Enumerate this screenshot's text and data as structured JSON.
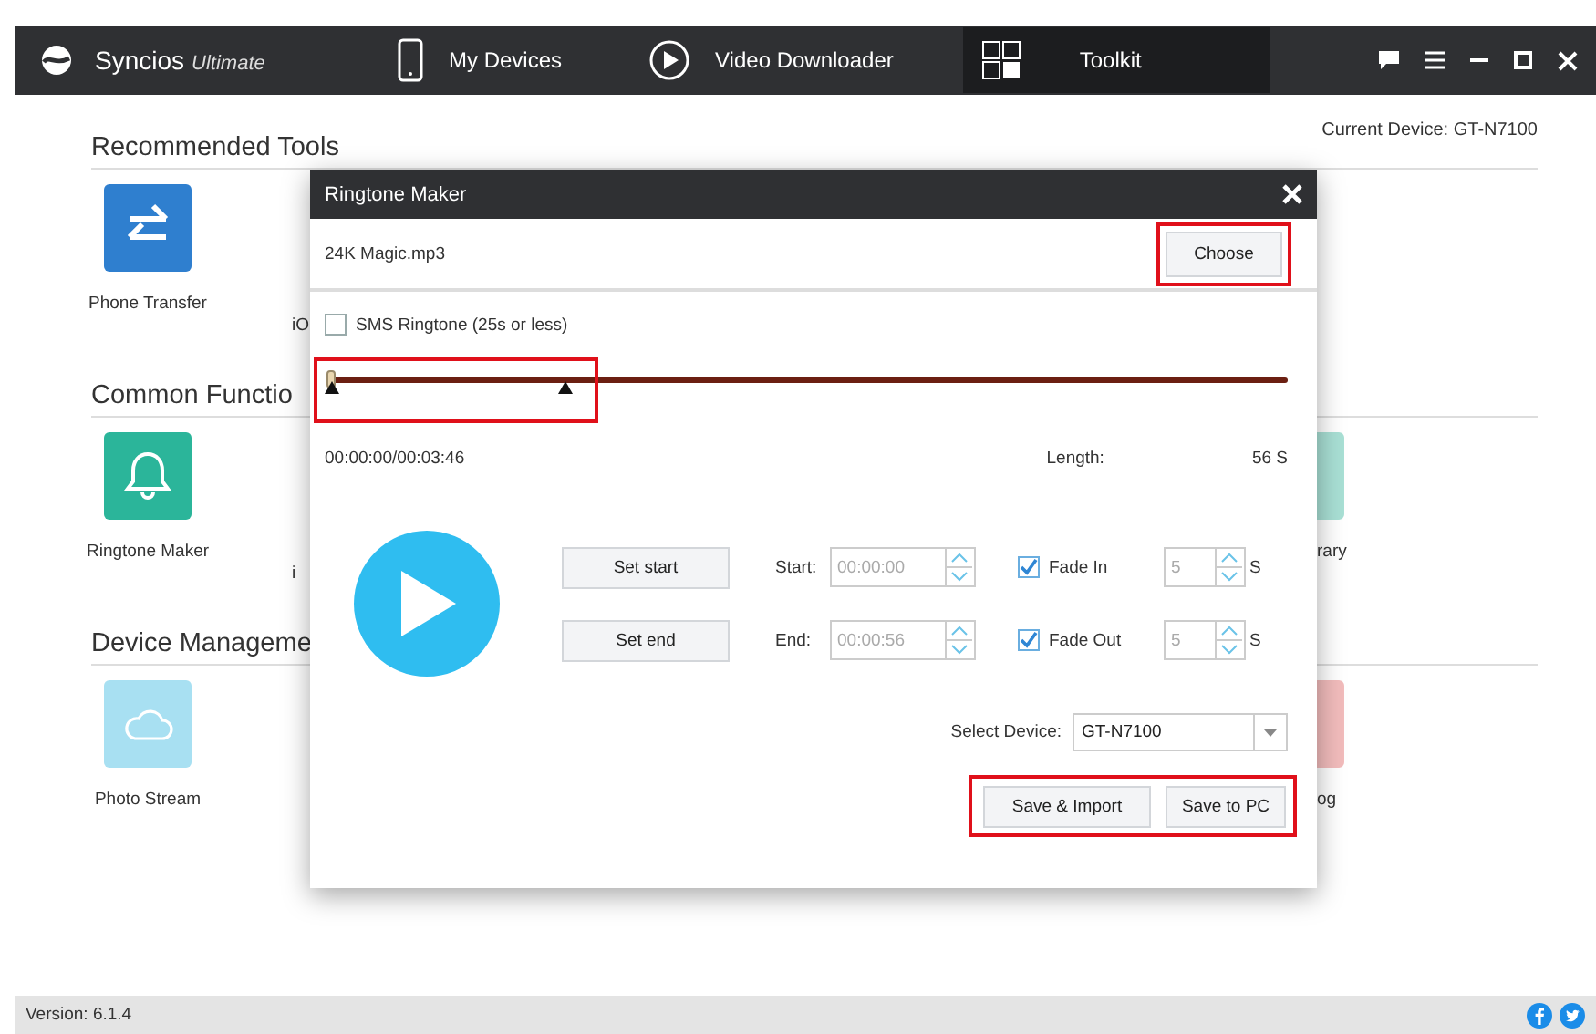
{
  "app_bar": {
    "brand": "Syncios",
    "edition": "Ultimate",
    "nav": [
      {
        "label": "My Devices",
        "selected": false
      },
      {
        "label": "Video Downloader",
        "selected": false
      },
      {
        "label": "Toolkit",
        "selected": true
      }
    ]
  },
  "current_device": "Current Device: GT-N7100",
  "sections": [
    {
      "title": "Recommended Tools",
      "tools": [
        {
          "kind": "tool",
          "label": "Phone Transfer",
          "color": "#2f7fcf"
        },
        {
          "kind": "fragment",
          "label": "iO"
        }
      ]
    },
    {
      "title": "Common Functio",
      "tools": [
        {
          "kind": "tool",
          "label": "Ringtone Maker",
          "color": "#2bb59a"
        },
        {
          "kind": "fragment",
          "label": "i"
        },
        {
          "kind": "edge",
          "label": "rary",
          "color": "#a9e0d5"
        }
      ]
    },
    {
      "title": "Device Manageme",
      "tools": [
        {
          "kind": "tool",
          "label": "Photo Stream",
          "color": "#a8e0f2"
        },
        {
          "kind": "edge",
          "label": "og",
          "color": "#f2bcbc"
        }
      ]
    }
  ],
  "dialog": {
    "title": "Ringtone Maker",
    "file": "24K Magic.mp3",
    "choose": "Choose",
    "choose_highlighted": true,
    "sms": {
      "label": "SMS Ringtone (25s or less)",
      "checked": false
    },
    "slider": {
      "level": 0,
      "start_marker": {
        "level": 0
      },
      "end_marker": {
        "level": 0.25
      },
      "highlighted": true
    },
    "time": "00:00:00/00:03:46",
    "length_label": "Length:",
    "length": "56 S",
    "rows": [
      {
        "button": "Set start",
        "label": "Start:",
        "value": "00:00:00",
        "fade": {
          "label": "Fade In",
          "checked": true
        },
        "seconds": "5",
        "unit": "S"
      },
      {
        "button": "Set end",
        "label": "End:",
        "value": "00:00:56",
        "fade": {
          "label": "Fade Out",
          "checked": true
        },
        "seconds": "5",
        "unit": "S"
      }
    ],
    "device_label": "Select Device:",
    "device": "GT-N7100",
    "actions": [
      "Save & Import",
      "Save to PC"
    ],
    "actions_highlighted": true
  },
  "footer": {
    "version": "Version: 6.1.4"
  }
}
